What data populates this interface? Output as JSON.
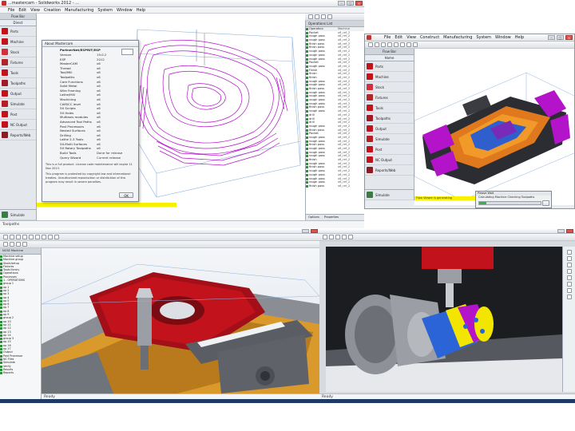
{
  "colors": {
    "accent_yellow": "#f7f100",
    "part_red": "#c2121c",
    "toolpath_magenta": "#b313c9",
    "fixture_orange": "#d99a2b",
    "progress_green": "#37b24d"
  },
  "screen1": {
    "title": "...mastercam - Solidworks 2012 - ...",
    "menu": [
      "File",
      "Edit",
      "View",
      "Creation",
      "Manufacturing",
      "System",
      "Window",
      "Help"
    ],
    "flow_header": "Flow Bar",
    "flow_subheader": "Direct",
    "flow_items": [
      "Parts",
      "Machine",
      "Stock",
      "Fixtures",
      "Tools",
      "Toolpaths",
      "Output",
      "Simulate",
      "Post",
      "NC Output",
      "Reports/Web"
    ],
    "flow_footer": "Simulate",
    "dialog": {
      "title": "About Mastercam",
      "heading": "PartnerNet/ESPRIT/ESP",
      "lines": [
        {
          "label": "Version",
          "value": "19.0.2"
        },
        {
          "label": "ESP",
          "value": "2012"
        },
        {
          "label": "MasterCAM",
          "value": "x6"
        },
        {
          "label": "Thread",
          "value": "x6"
        },
        {
          "label": "Tool/Mill",
          "value": "x6"
        },
        {
          "label": "Toolpaths",
          "value": "x6"
        },
        {
          "label": "Core Functions",
          "value": "x6"
        },
        {
          "label": "Solid Metal",
          "value": "x6"
        },
        {
          "label": "Wire Framing",
          "value": "x6"
        },
        {
          "label": "Lathe/Mill",
          "value": "x6"
        },
        {
          "label": "Machining",
          "value": "x6"
        },
        {
          "label": "CAM/CC level",
          "value": "x6"
        },
        {
          "label": "5X Scripts",
          "value": "x6"
        },
        {
          "label": "5X Holes",
          "value": "x6"
        },
        {
          "label": "Multiaxis modules",
          "value": "x6"
        },
        {
          "label": "Advanced Tool Paths",
          "value": "x6"
        },
        {
          "label": "Post Processors",
          "value": "x6"
        },
        {
          "label": "Nested Surfaces",
          "value": "x6"
        },
        {
          "label": "Drilling",
          "value": "x6"
        },
        {
          "label": "Lathe 2-3 Tools",
          "value": "x6"
        },
        {
          "label": "5X-Multi Surfaces",
          "value": "x6"
        },
        {
          "label": "5X Rotary Toolpaths",
          "value": "x6"
        },
        {
          "label": "Build Tools",
          "value": "Done for release"
        },
        {
          "label": "Query Wizard",
          "value": "Current release"
        }
      ],
      "note1": "This is a full product. License code maintenance will expire 11 Nov 2013.",
      "note2": "This program is protected by copyright law and international treaties. Unauthorized reproduction or distribution of this program may result in severe penalties.",
      "ok_label": "OK"
    },
    "tree_header": "Operations List",
    "tree_col_header": [
      "Operation",
      "Machine"
    ],
    "tree_rows": [
      [
        "Pocket",
        "x6_ref_2"
      ],
      [
        "rough pass",
        "x6_ref_2"
      ],
      [
        "rough pass",
        "x6_ref_2"
      ],
      [
        "finish pass",
        "x6_ref_2"
      ],
      [
        "finish pass",
        "x6_ref_2"
      ],
      [
        "rough pass",
        "x6_ref_2"
      ],
      [
        "rough pass",
        "x6_ref_2"
      ],
      [
        "rough pass",
        "x6_ref_2"
      ],
      [
        "Pocket",
        "x6_ref_2"
      ],
      [
        "rough pass",
        "x6_ref_2"
      ],
      [
        "Finish",
        "x6_ref_2"
      ],
      [
        "finish",
        "x6_ref_2"
      ],
      [
        "finish",
        "x6_ref_2"
      ],
      [
        "rough pass",
        "x6_ref_2"
      ],
      [
        "rough pass",
        "x6_ref_2"
      ],
      [
        "finish pass",
        "x6_ref_2"
      ],
      [
        "rough pass",
        "x6_ref_2"
      ],
      [
        "rough pass",
        "x6_ref_2"
      ],
      [
        "rough pass",
        "x6_ref_2"
      ],
      [
        "rough pass",
        "x6_ref_2"
      ],
      [
        "finish pass",
        "x6_ref_2"
      ],
      [
        "rough pass",
        "x6_ref_2"
      ],
      [
        "drill",
        "x6_ref_2"
      ],
      [
        "drill",
        "x6_ref_2"
      ],
      [
        "drill",
        "x6_ref_2"
      ],
      [
        "rough pass",
        "x6_ref_2"
      ],
      [
        "finish pass",
        "x6_ref_2"
      ],
      [
        "Pocket",
        "x6_ref_2"
      ],
      [
        "rough pass",
        "x6_ref_2"
      ],
      [
        "rough pass",
        "x6_ref_2"
      ],
      [
        "finish pass",
        "x6_ref_2"
      ],
      [
        "rough pass",
        "x6_ref_2"
      ],
      [
        "rough pass",
        "x6_ref_2"
      ],
      [
        "rough pass",
        "x6_ref_2"
      ],
      [
        "finish",
        "x6_ref_2"
      ],
      [
        "rough pass",
        "x6_ref_2"
      ],
      [
        "finish pass",
        "x6_ref_2"
      ],
      [
        "rough pass",
        "x6_ref_2"
      ],
      [
        "rough pass",
        "x6_ref_2"
      ],
      [
        "rough pass",
        "x6_ref_2"
      ],
      [
        "rough pass",
        "x6_ref_2"
      ],
      [
        "finish pass",
        "x6_ref_2"
      ]
    ],
    "tree_footer": [
      "Options",
      "Properties"
    ],
    "status_left": "Toolpaths"
  },
  "screen2": {
    "menu": [
      "File",
      "Edit",
      "View",
      "Construct",
      "Manufacturing",
      "System",
      "Window",
      "Help"
    ],
    "flow_header": "Flow Bar",
    "flow_subheader": "Home",
    "flow_items": [
      "Parts",
      "Machine",
      "Stock",
      "Fixtures",
      "Tools",
      "Toolpaths",
      "Output",
      "Simulate",
      "Post",
      "NC Output",
      "Reports/Web"
    ],
    "flow_footer": "Simulate",
    "yellow_text": "Flow Viewer is generating",
    "progress": {
      "title": "Please Wait",
      "text": "Calculating Machine Checking Toolpaths",
      "percent": 12
    }
  },
  "screen3": {
    "tree_header": "NCSE Machine",
    "tree_rows": [
      "Machine setup",
      "Machine group",
      "Stock/setup",
      "Fixtures",
      "Tools library",
      "Operations",
      "Processes",
      "1 - OPERATIONS",
      "group 1",
      "op 1",
      "op 2",
      "op 3",
      "op 4",
      "op 5",
      "op 6",
      "op 7",
      "op 8",
      "op 9",
      "group 2",
      "op 10",
      "op 11",
      "op 12",
      "op 13",
      "op 14",
      "group 3",
      "op 15",
      "op 16",
      "op 17",
      "Output",
      "Post Processor",
      "NC Files",
      "Simulate",
      "Verify",
      "Results",
      "Reports"
    ],
    "status": "Ready"
  },
  "screen4": {
    "status": "Ready"
  }
}
